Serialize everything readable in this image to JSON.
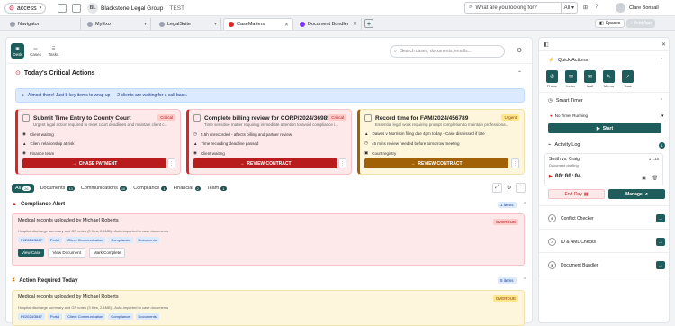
{
  "top": {
    "logo": "access",
    "firm": "Blackstone Legal Group",
    "firm_initials": "BL",
    "env": "TEST",
    "search_placeholder": "What are you looking for?",
    "scope": "All",
    "user": "Clare Bonsall",
    "spaces": "Spaces",
    "add_app": "Add App"
  },
  "tabs": [
    {
      "label": "Navigator",
      "color": "#6b7280"
    },
    {
      "label": "MyExo",
      "color": "#6b7280"
    },
    {
      "label": "LegalSuite",
      "color": "#6b7280"
    },
    {
      "label": "CaseMatters",
      "color": "#dc2626"
    },
    {
      "label": "Document Bundler",
      "color": "#7c3aed"
    }
  ],
  "nav": {
    "desk": "Desk",
    "cases": "Cases",
    "tasks": "Tasks",
    "search_placeholder": "Search cases, documents, emails..."
  },
  "critical": {
    "title": "Today's Critical Actions",
    "banner": "Almost there! Just 8 key items to wrap up — 2 clients are waiting for a call-back."
  },
  "cards": [
    {
      "title": "Submit Time Entry to County Court",
      "badge": "Critical",
      "sub": "Urgent legal action required to meet court deadlines and maintain client c...",
      "rows": [
        "Client waiting",
        "Client relationship at risk",
        "Finance team"
      ],
      "cta": "CHASE PAYMENT"
    },
    {
      "title": "Complete billing review for CORP/2024/369852",
      "badge": "Critical",
      "sub": "Time sensitive matter requiring immediate attention to avoid compliance i...",
      "rows": [
        "5.5h unrecorded - affects billing and partner review",
        "Time recording deadline passed",
        "Client waiting"
      ],
      "cta": "REVIEW CONTRACT"
    },
    {
      "title": "Record time for FAM/2024/456789",
      "badge": "Urgent",
      "sub": "Essential legal work requiring prompt completion to maintain professiona...",
      "rows": [
        "Dawes v Morrison filing due 4pm today - Case dismissed if late",
        "45 mins review needed before tomorrow meeting",
        "Court registry"
      ],
      "cta": "REVIEW CONTRACT"
    }
  ],
  "filters": [
    {
      "label": "All",
      "count": "26"
    },
    {
      "label": "Documents",
      "count": "13"
    },
    {
      "label": "Communications",
      "count": "10"
    },
    {
      "label": "Compliance",
      "count": "1"
    },
    {
      "label": "Financial",
      "count": "2"
    },
    {
      "label": "Team",
      "count": "1"
    }
  ],
  "groups": [
    {
      "title": "Compliance Alert",
      "count": "1 items",
      "item_title": "Medical records uploaded by Michael Roberts",
      "status": "OVERDUE",
      "desc": "Hospital discharge summary and GP notes (3 files, 2.4MB) - Auto-imported to case documents",
      "chips": [
        "PI/2024/3847",
        "Portal",
        "Client Communication",
        "Compliance",
        "Documents"
      ],
      "actions": [
        "View Case",
        "View Document",
        "Mark Complete"
      ]
    },
    {
      "title": "Action Required Today",
      "count": "5 items",
      "item_title": "Medical records uploaded by Michael Roberts",
      "status": "OVERDUE",
      "desc": "Hospital discharge summary and GP notes (3 files, 2.4MB) - Auto-imported to case documents",
      "chips": [
        "PI/2024/3847",
        "Portal",
        "Client Communication",
        "Compliance",
        "Documents"
      ]
    }
  ],
  "quick": {
    "title": "Quick Actions",
    "items": [
      "Phone",
      "Letter",
      "Mail",
      "Memo",
      "Task"
    ]
  },
  "timer": {
    "title": "Smart Timer",
    "status": "No Timer Running",
    "start": "Start"
  },
  "activity": {
    "title": "Activity Log",
    "count": "1",
    "item": "Smith vs. Craig",
    "item_sub": "Document drafting",
    "time": "17:15",
    "elapsed": "00:00:04",
    "end_day": "End Day",
    "manage": "Manage"
  },
  "tools": [
    "Conflict Checker",
    "ID & AML Checks",
    "Document Bundler"
  ]
}
